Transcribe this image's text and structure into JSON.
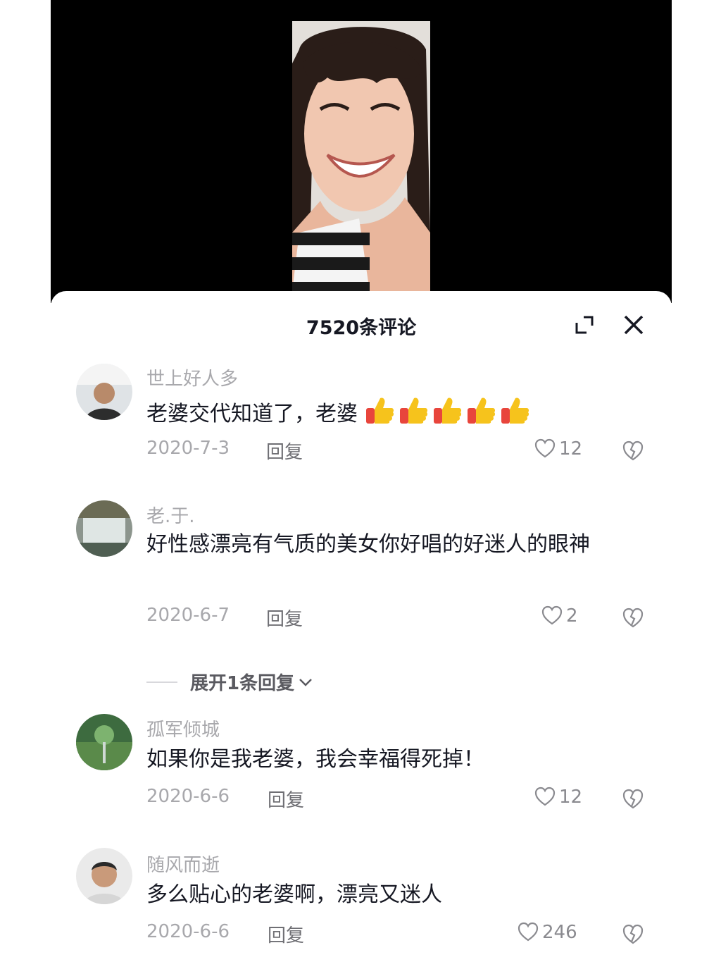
{
  "panel": {
    "title": "7520条评论",
    "expand_icon": "expand-icon",
    "close_icon": "close-icon"
  },
  "comments": [
    {
      "username": "世上好人多",
      "text": "老婆交代知道了，老婆",
      "emoji": [
        "thumbs-up",
        "thumbs-up",
        "thumbs-up",
        "thumbs-up",
        "thumbs-up"
      ],
      "date": "2020-7-3",
      "reply": "回复",
      "likes": "12"
    },
    {
      "username": "老.于.",
      "text": "好性感漂亮有气质的美女你好唱的好迷人的眼神",
      "date": "2020-6-7",
      "reply": "回复",
      "likes": "2",
      "expand_replies": "展开1条回复"
    },
    {
      "username": "孤军倾城",
      "text": "如果你是我老婆，我会幸福得死掉！",
      "date": "2020-6-6",
      "reply": "回复",
      "likes": "12"
    },
    {
      "username": "随风而逝",
      "text": "多么贴心的老婆啊，漂亮又迷人",
      "date": "2020-6-6",
      "reply": "回复",
      "likes": "246"
    }
  ],
  "colors": {
    "background": "#ffffff",
    "video_bg": "#000000",
    "title": "#161823",
    "muted": "#a8a8ac",
    "thumb_yellow": "#f6c31c",
    "thumb_red": "#e8453c"
  }
}
